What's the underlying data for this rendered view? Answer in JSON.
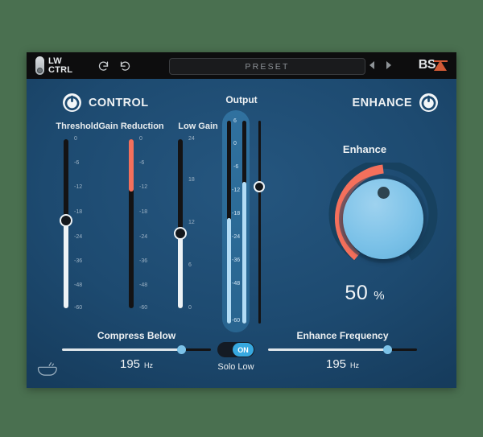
{
  "window": {
    "bg_outer": "#4a7050",
    "accent_blue": "#7cc2e8",
    "accent_red": "#f4705c",
    "brand_orange": "#d15a36"
  },
  "topbar": {
    "logo_line1": "LW",
    "logo_line2": "CTRL",
    "undo_icon": "undo-icon",
    "redo_icon": "redo-icon",
    "preset_value": "PRESET",
    "preset_placeholder": "PRESET",
    "prev_label": "prev-preset",
    "next_label": "next-preset",
    "brand_text": "BS",
    "brand_mark": "A"
  },
  "sections": {
    "control": {
      "title": "CONTROL",
      "power_icon": "power-icon"
    },
    "enhance": {
      "title": "ENHANCE",
      "power_icon": "power-icon"
    }
  },
  "vertical_sliders": [
    {
      "name": "threshold",
      "label": "Threshold",
      "scale": [
        "0",
        "-6",
        "-12",
        "-18",
        "-24",
        "-36",
        "-48",
        "-60"
      ],
      "value_db": -18,
      "fill_color": "#eef3f6",
      "knob_pos_pct": 48
    },
    {
      "name": "gain-reduction",
      "label": "Gain Reduction",
      "scale": [
        "0",
        "-6",
        "-12",
        "-18",
        "-24",
        "-36",
        "-48",
        "-60"
      ],
      "value_db": -12,
      "fill_color": "#f4705c",
      "fill_pct": 31
    },
    {
      "name": "low-gain",
      "label": "Low Gain",
      "scale": [
        "24",
        "18",
        "12",
        "6",
        "0"
      ],
      "value_db": 11,
      "fill_color": "#eef3f6",
      "knob_pos_pct": 56
    }
  ],
  "output": {
    "label": "Output",
    "scale": [
      "6",
      "0",
      "-6",
      "-12",
      "-18",
      "-24",
      "-36",
      "-48",
      "-60"
    ],
    "meter_left_pct": 52,
    "meter_right_pct": 70,
    "fader_pos_pct": 30,
    "fader_name": "output-fader"
  },
  "enhance_knob": {
    "label": "Enhance",
    "value": "50",
    "unit": "%",
    "arc_fill_color": "#f4705c",
    "arc_bg_color": "#17415f"
  },
  "horizontal_sliders": [
    {
      "name": "compress-below",
      "label": "Compress Below",
      "value": "195",
      "unit": "Hz",
      "pos_pct": 80
    },
    {
      "name": "enhance-frequency",
      "label": "Enhance Frequency",
      "value": "195",
      "unit": "Hz",
      "pos_pct": 80
    }
  ],
  "solo": {
    "toggle_state": "ON",
    "label": "Solo Low"
  },
  "footer": {
    "icon": "bowl-icon"
  }
}
